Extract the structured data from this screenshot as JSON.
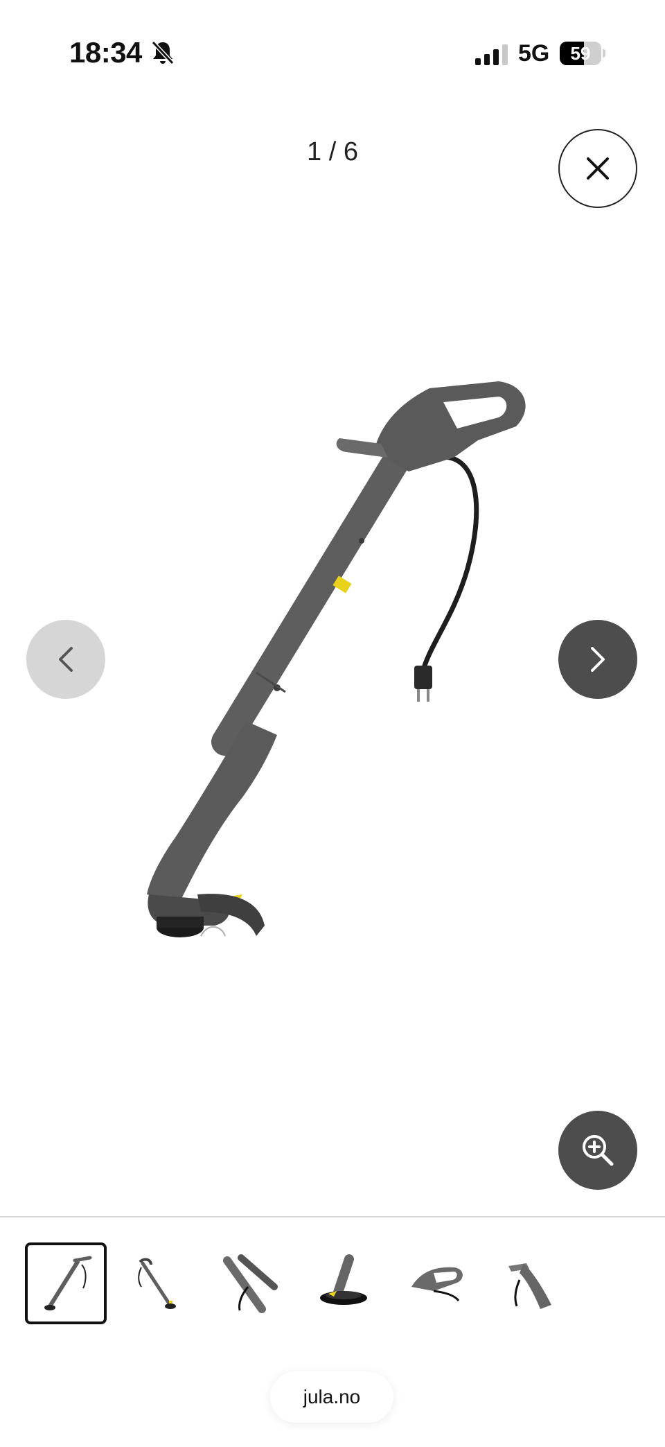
{
  "status_bar": {
    "time": "18:34",
    "silent_icon": "bell-slash-icon",
    "signal_icon": "cellular-signal-icon",
    "network": "5G",
    "battery_percent": "59",
    "battery_level": 0.59
  },
  "gallery": {
    "counter": "1 / 6",
    "close_icon": "close-icon",
    "prev_icon": "chevron-left-icon",
    "next_icon": "chevron-right-icon",
    "zoom_icon": "zoom-in-icon",
    "current_index": 1,
    "total": 6,
    "product_image": "grass-trimmer-image",
    "thumbnails": [
      {
        "name": "thumb-1",
        "active": true
      },
      {
        "name": "thumb-2",
        "active": false
      },
      {
        "name": "thumb-3",
        "active": false
      },
      {
        "name": "thumb-4",
        "active": false
      },
      {
        "name": "thumb-5",
        "active": false
      },
      {
        "name": "thumb-6",
        "active": false
      }
    ]
  },
  "browser": {
    "url": "jula.no"
  },
  "colors": {
    "dark_button": "#4d4d4d",
    "disabled_button": "#d6d6d6",
    "product_gray": "#5e5e5e",
    "accent_yellow": "#e8d31a"
  }
}
